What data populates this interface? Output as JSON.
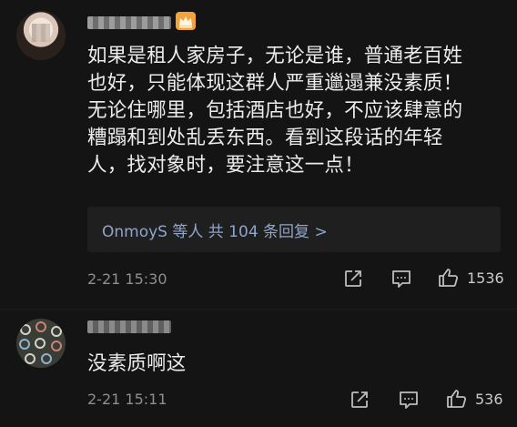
{
  "comments": [
    {
      "text_lines": [
        "如果是租人家房子，无论是谁，普通老百姓",
        "也好，只能体现这群人严重邋遢兼没素质！",
        "无论住哪里，包括酒店也好，不应该肆意的",
        "糟蹋和到处乱丢东西。看到这段话的年轻",
        "人，找对象时，要注意这一点！"
      ],
      "replies_prefix": "OnmoyS 等人",
      "replies_link": "共 104 条回复 >",
      "time": "2-21 15:30",
      "likes": "1536"
    },
    {
      "text": "没素质啊这",
      "time": "2-21 15:11",
      "likes": "536"
    }
  ],
  "icons": {
    "share": "share-icon",
    "reply": "comment-icon",
    "like": "thumbs-up-icon",
    "badge": "crown-badge-icon"
  },
  "colors": {
    "background": "#141414",
    "text": "#ececec",
    "meta": "#8e8e8e",
    "link": "#8fa5c9",
    "reply_box": "#1f1f1f",
    "badge": "#f2a33a"
  }
}
